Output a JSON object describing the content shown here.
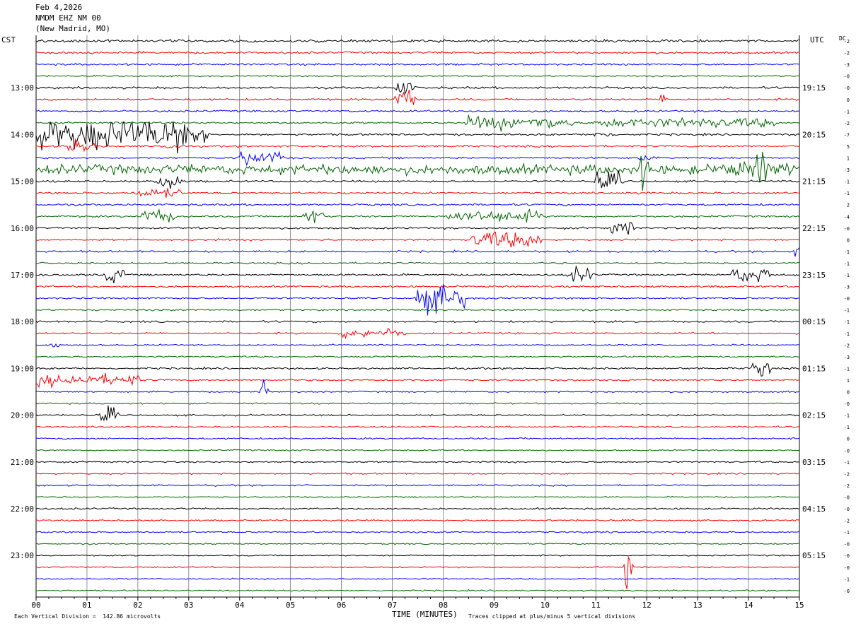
{
  "header": {
    "date": "Feb 4,2026",
    "station": "NMDM EHZ NM 00",
    "location": "(New Madrid, MO)"
  },
  "left_timezone_label": "CST",
  "right_timezone_label": "UTC",
  "dc_label": "DC",
  "footer": {
    "vertical_division": "Each Vertical Division =  142.86 microvolts",
    "clip_note": "Traces clipped at plus/minus 5 vertical divisions"
  },
  "colors": {
    "trace_cycle": [
      "#000000",
      "#ff0000",
      "#0000ff",
      "#006400"
    ],
    "gridline": "#777777"
  },
  "chart_data": {
    "type": "line",
    "subtype": "helicorder",
    "xlabel": "TIME (MINUTES)",
    "xlim": [
      0,
      15
    ],
    "x_ticks": [
      "00",
      "01",
      "02",
      "03",
      "04",
      "05",
      "06",
      "07",
      "08",
      "09",
      "10",
      "11",
      "12",
      "13",
      "14",
      "15"
    ],
    "trace_minutes": 15,
    "row_count": 48,
    "left_hour_labels": [
      {
        "row": 4,
        "label": "13:00"
      },
      {
        "row": 8,
        "label": "14:00"
      },
      {
        "row": 12,
        "label": "15:00"
      },
      {
        "row": 16,
        "label": "16:00"
      },
      {
        "row": 20,
        "label": "17:00"
      },
      {
        "row": 24,
        "label": "18:00"
      },
      {
        "row": 28,
        "label": "19:00"
      },
      {
        "row": 32,
        "label": "20:00"
      },
      {
        "row": 36,
        "label": "21:00"
      },
      {
        "row": 40,
        "label": "22:00"
      },
      {
        "row": 44,
        "label": "23:00"
      }
    ],
    "right_hour_labels": [
      {
        "row": 4,
        "label": "19:15"
      },
      {
        "row": 8,
        "label": "20:15"
      },
      {
        "row": 12,
        "label": "21:15"
      },
      {
        "row": 16,
        "label": "22:15"
      },
      {
        "row": 20,
        "label": "23:15"
      },
      {
        "row": 24,
        "label": "00:15"
      },
      {
        "row": 28,
        "label": "01:15"
      },
      {
        "row": 32,
        "label": "02:15"
      },
      {
        "row": 36,
        "label": "03:15"
      },
      {
        "row": 40,
        "label": "04:15"
      },
      {
        "row": 44,
        "label": "05:15"
      }
    ],
    "dc_offsets": [
      "-2",
      "-2",
      "-3",
      "-0",
      "-0",
      "0",
      "-1",
      "-2",
      "-7",
      "5",
      "1",
      "-3",
      "-1",
      "-1",
      "2",
      "-4",
      "-0",
      "0",
      "-1",
      "-1",
      "-1",
      "-3",
      "-0",
      "-1",
      "-1",
      "-1",
      "-2",
      "-3",
      "-1",
      "1",
      "0",
      "-0",
      "-1",
      "-1",
      "0",
      "-0",
      "-1",
      "-2",
      "-2",
      "-0",
      "-0",
      "-2",
      "-1",
      "-0",
      "-0",
      "-0",
      "-1",
      "-0"
    ],
    "noise_levels": [
      1.3,
      1.1,
      1.0,
      0.8,
      1.1,
      1.0,
      1.0,
      1.0,
      1.1,
      1.0,
      1.0,
      1.0,
      1.0,
      1.0,
      1.0,
      1.0,
      1.0,
      1.0,
      1.0,
      0.9,
      1.0,
      1.0,
      0.9,
      0.9,
      1.0,
      0.9,
      0.8,
      0.8,
      1.0,
      0.9,
      0.8,
      0.8,
      0.9,
      0.8,
      0.8,
      0.7,
      0.8,
      0.8,
      0.8,
      0.7,
      0.9,
      0.8,
      0.8,
      0.7,
      0.7,
      0.7,
      0.7,
      0.7
    ],
    "events": [
      {
        "row": 4,
        "minute": 7.1,
        "amplitude": 8,
        "duration": 0.3
      },
      {
        "row": 5,
        "minute": 7.1,
        "amplitude": 10,
        "duration": 0.35
      },
      {
        "row": 5,
        "minute": 12.3,
        "amplitude": 6,
        "duration": 0.05
      },
      {
        "row": 7,
        "minute": 8.5,
        "amplitude": 7,
        "duration": 2.0
      },
      {
        "row": 7,
        "minute": 11.0,
        "amplitude": 5,
        "duration": 3.5
      },
      {
        "row": 8,
        "minute": 0.0,
        "amplitude": 16,
        "duration": 3.3
      },
      {
        "row": 8,
        "minute": 11.0,
        "amplitude": 4,
        "duration": 0.3
      },
      {
        "row": 9,
        "minute": 0.6,
        "amplitude": 8,
        "duration": 0.5
      },
      {
        "row": 9,
        "minute": 2.5,
        "amplitude": 4,
        "duration": 0.3
      },
      {
        "row": 10,
        "minute": 4.0,
        "amplitude": 7,
        "duration": 0.8
      },
      {
        "row": 10,
        "minute": 11.9,
        "amplitude": 9,
        "duration": 0.1
      },
      {
        "row": 11,
        "minute": 0.0,
        "amplitude": 5,
        "duration": 15
      },
      {
        "row": 11,
        "minute": 11.9,
        "amplitude": 20,
        "duration": 0.1
      },
      {
        "row": 11,
        "minute": 14.2,
        "amplitude": 26,
        "duration": 0.1
      },
      {
        "row": 11,
        "minute": 13.5,
        "amplitude": 9,
        "duration": 1.3
      },
      {
        "row": 12,
        "minute": 2.4,
        "amplitude": 9,
        "duration": 0.4
      },
      {
        "row": 12,
        "minute": 11.0,
        "amplitude": 9,
        "duration": 0.5
      },
      {
        "row": 13,
        "minute": 2.0,
        "amplitude": 5,
        "duration": 0.8
      },
      {
        "row": 15,
        "minute": 2.1,
        "amplitude": 7,
        "duration": 0.6
      },
      {
        "row": 15,
        "minute": 5.3,
        "amplitude": 9,
        "duration": 0.3
      },
      {
        "row": 15,
        "minute": 8.1,
        "amplitude": 6,
        "duration": 1.8
      },
      {
        "row": 16,
        "minute": 11.3,
        "amplitude": 7,
        "duration": 0.4
      },
      {
        "row": 17,
        "minute": 8.6,
        "amplitude": 9,
        "duration": 1.3
      },
      {
        "row": 18,
        "minute": 14.9,
        "amplitude": 6,
        "duration": 0.1
      },
      {
        "row": 20,
        "minute": 1.4,
        "amplitude": 8,
        "duration": 0.3
      },
      {
        "row": 20,
        "minute": 10.5,
        "amplitude": 8,
        "duration": 0.4
      },
      {
        "row": 20,
        "minute": 13.7,
        "amplitude": 8,
        "duration": 0.7
      },
      {
        "row": 22,
        "minute": 7.5,
        "amplitude": 14,
        "duration": 0.9
      },
      {
        "row": 25,
        "minute": 6.0,
        "amplitude": 5,
        "duration": 1.2
      },
      {
        "row": 26,
        "minute": 0.35,
        "amplitude": 7,
        "duration": 0.05
      },
      {
        "row": 28,
        "minute": 14.1,
        "amplitude": 9,
        "duration": 0.3
      },
      {
        "row": 29,
        "minute": 0.0,
        "amplitude": 6,
        "duration": 2.0
      },
      {
        "row": 30,
        "minute": 4.45,
        "amplitude": 12,
        "duration": 0.05
      },
      {
        "row": 32,
        "minute": 1.3,
        "amplitude": 9,
        "duration": 0.25
      },
      {
        "row": 45,
        "minute": 11.6,
        "amplitude": 30,
        "duration": 0.05
      }
    ]
  }
}
